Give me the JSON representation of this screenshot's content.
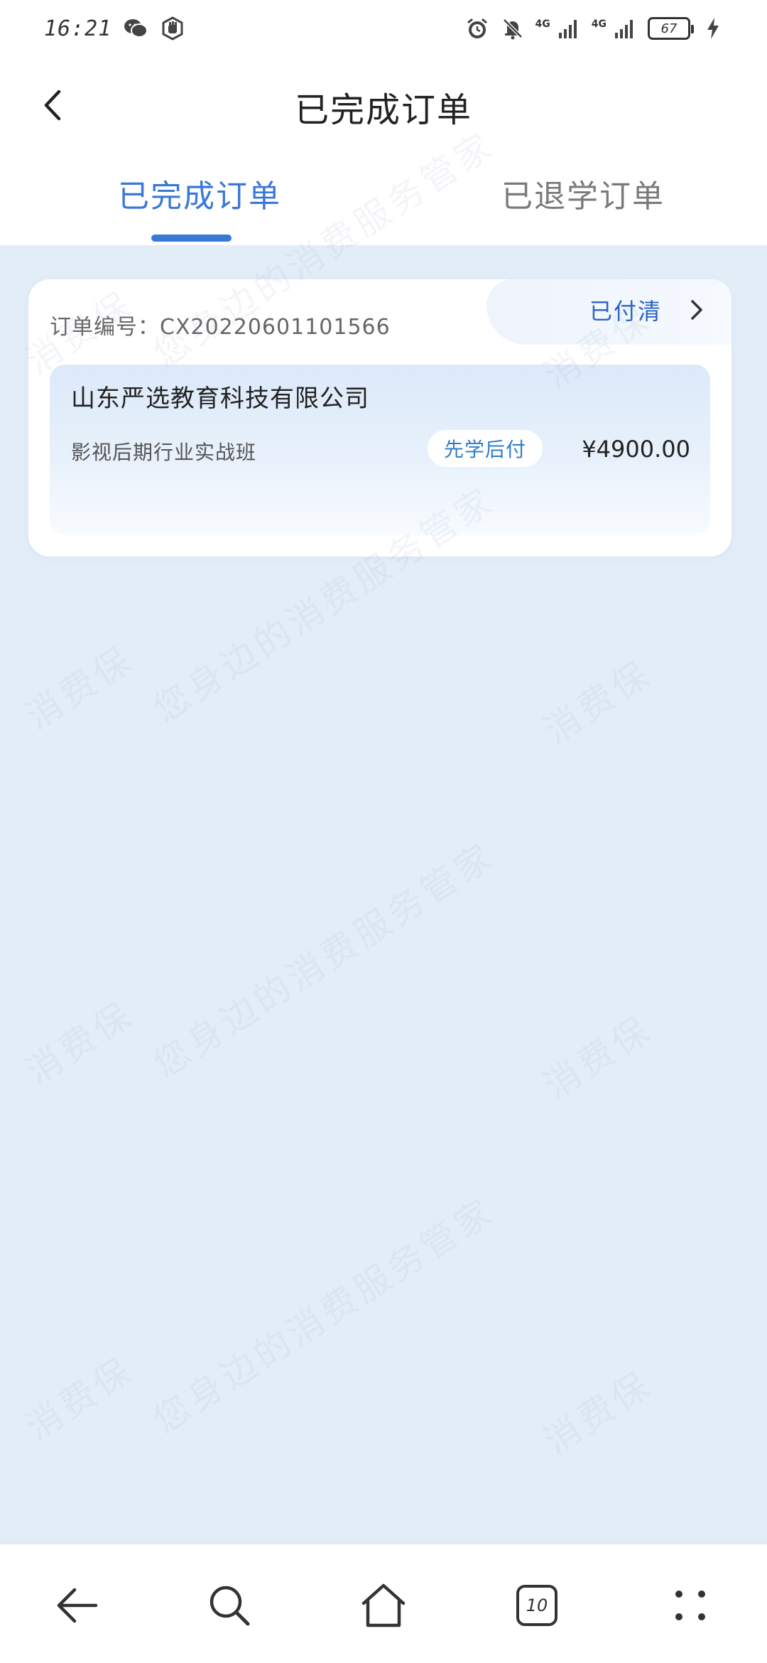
{
  "status_bar": {
    "time": "16:21",
    "net_label_1": "4G",
    "net_label_2": "4G",
    "battery": "67"
  },
  "header": {
    "title": "已完成订单",
    "tabs": [
      {
        "label": "已完成订单",
        "active": true
      },
      {
        "label": "已退学订单",
        "active": false
      }
    ]
  },
  "order": {
    "order_no_label": "订单编号：",
    "order_no": "CX20220601101566",
    "status": "已付清",
    "company": "山东严选教育科技有限公司",
    "course": "影视后期行业实战班",
    "payment_type": "先学后付",
    "price": "¥4900.00"
  },
  "watermark": {
    "line_a": "消费保",
    "line_b": "您身边的消费服务管家"
  },
  "bottom_nav": {
    "tab_count": "10"
  },
  "colors": {
    "accent": "#3a78d8",
    "background": "#e3edf8",
    "badge_text": "#2f7ecb"
  }
}
